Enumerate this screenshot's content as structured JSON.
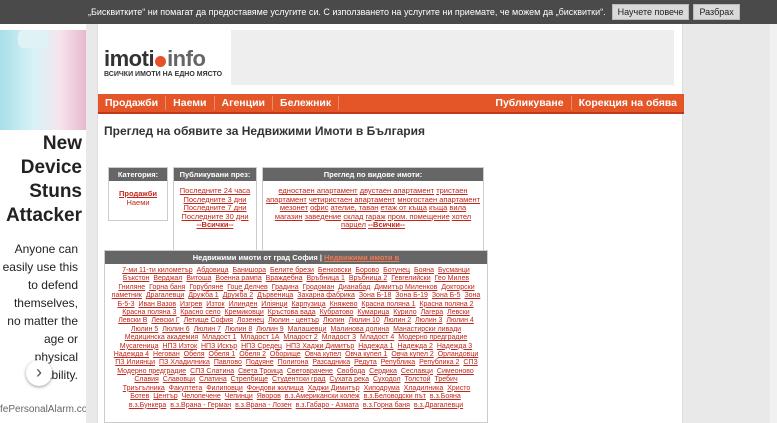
{
  "cookie": {
    "text": "„Бисквитките“ ни помагат да предоставяме услугите си. С използването на услугите ни приемате, че можем да „бисквитки“.",
    "learn_more": "Научете повече",
    "ok": "Разбрах"
  },
  "left_ad": {
    "headline": "New Device Stuns Attacker",
    "description": "Anyone can easily use this to defend themselves, no matter the age or physical ability.",
    "url": "fePersonalAlarm.com"
  },
  "logo": {
    "name_a": "imoti",
    "name_b": "info",
    "tagline": "ВСИЧКИ ИМОТИ НА ЕДНО МЯСТО"
  },
  "nav": {
    "left": [
      "Продажби",
      "Наеми",
      "Агенции",
      "Бележник"
    ],
    "right": [
      "Публикуване",
      "Корекция на обява"
    ]
  },
  "page_title": "Преглед на обявите за Недвижими Имоти в България",
  "category_box": {
    "header": "Категория:",
    "links": [
      "Продажби",
      "Наеми"
    ]
  },
  "published_box": {
    "header": "Публикувани през:",
    "links": [
      "Последните 24 часа",
      "Последните 3 дни",
      "Последните 7 дни",
      "Последните 30 дни",
      "--Всички--"
    ]
  },
  "types_box": {
    "header": "Преглед по видове имоти:",
    "links": [
      "едностаен апартамент",
      "двустаен апартамент",
      "тристаен апартамент",
      "четиристаен апартамент",
      "многостаен апартамент",
      "мезонет",
      "офис",
      "ателие, таван",
      "етаж от къща",
      "къща",
      "вила",
      "магазин",
      "заведение",
      "склад",
      "гараж",
      "пром. помещение",
      "хотел",
      "парцел",
      "--Всички--"
    ]
  },
  "city_box": {
    "header": "Недвижими имоти от град София",
    "header_link": "Недвижими имоти в",
    "links": [
      "7-ми 11-ти километър",
      "Абдовица",
      "Банишора",
      "Белите брези",
      "Бенковски",
      "Борово",
      "Ботунец",
      "Бояна",
      "Бусманци",
      "Бъкстон",
      "Верджал",
      "Витоша",
      "Военна рампа",
      "Враждебна",
      "Връбница 1",
      "Връбница 2",
      "Гевгелийски",
      "Гео Милев",
      "Гниляне",
      "Горна баня",
      "Горубляне",
      "Гоце Делчев",
      "Градина",
      "Гродоман",
      "Дианабад",
      "Димитър Миленков",
      "Докторски паметник",
      "Драгалевци",
      "Дружба 1",
      "Дружба 2",
      "Дървеница",
      "Захарна фабрика",
      "Зона Б-18",
      "Зона Б-19",
      "Зона Б-5",
      "Зона Б-5-3",
      "Иван Вазов",
      "Изгрев",
      "Изток",
      "Илинден",
      "Иліянци",
      "Карпузица",
      "Княжево",
      "Красна поляна 1",
      "Красна поляна 2",
      "Красна поляна 3",
      "Красно село",
      "Кремиковци",
      "Кръстова вада",
      "Кубратово",
      "Кумарица",
      "Курило",
      "Лагера",
      "Левски",
      "Левски В",
      "Левски Г",
      "Летище София",
      "Лозенец",
      "Люлин - център",
      "Люлин",
      "Люлин 10",
      "Люлин 2",
      "Люлин 3",
      "Люлин 4",
      "Люлин 5",
      "Люлин 6",
      "Люлин 7",
      "Люлин 8",
      "Люлин 9",
      "Малашевци",
      "Малинова долина",
      "Манастирски ливади",
      "Медицинска академия",
      "Младост 1",
      "Младост 1А",
      "Младост 2",
      "Младост 3",
      "Младост 4",
      "Модерно предградие",
      "Мусагеница",
      "НПЗ Изток",
      "НПЗ Искър",
      "НПЗ Средец",
      "НПЗ Хаджи Димитър",
      "Надежда 1",
      "Надежда 2",
      "Надежда 3",
      "Надежда 4",
      "Негован",
      "Обеля",
      "Обеля 1",
      "Обеля 2",
      "Оборище",
      "Овча купел",
      "Овча купел 1",
      "Овча купел 2",
      "Орландовци",
      "ПЗ Илиянци",
      "ПЗ Хладилника",
      "Павлово",
      "Подуяне",
      "Полигона",
      "Разсадника",
      "Редута",
      "Република",
      "Република 2",
      "СПЗ Модерно предградие",
      "СПЗ Слатина",
      "Света Троица",
      "Световрачене",
      "Свобода",
      "Сердика",
      "Сеславци",
      "Симеоново",
      "Славия",
      "Славовци",
      "Слатина",
      "Стрелбище",
      "Студентски град",
      "Сухата река",
      "Суходол",
      "Толстой",
      "Требич",
      "Триъгълника",
      "Факултета",
      "Филиповци",
      "Фондови жилища",
      "Хаджи Димитър",
      "Хиподрума",
      "Хладилника",
      "Христо Ботев",
      "Център",
      "Челопечене",
      "Чепинци",
      "Яворов",
      "в.з.Американски колеж",
      "в.з.Беловодски път",
      "в.з.Бояна",
      "в.з.Бункера",
      "в.з.Врана - Герман",
      "в.з.Врана - Лозен",
      "в.з.Габаро - Азмата",
      "в.з.Горна баня",
      "в.з.Драгалевци"
    ]
  }
}
